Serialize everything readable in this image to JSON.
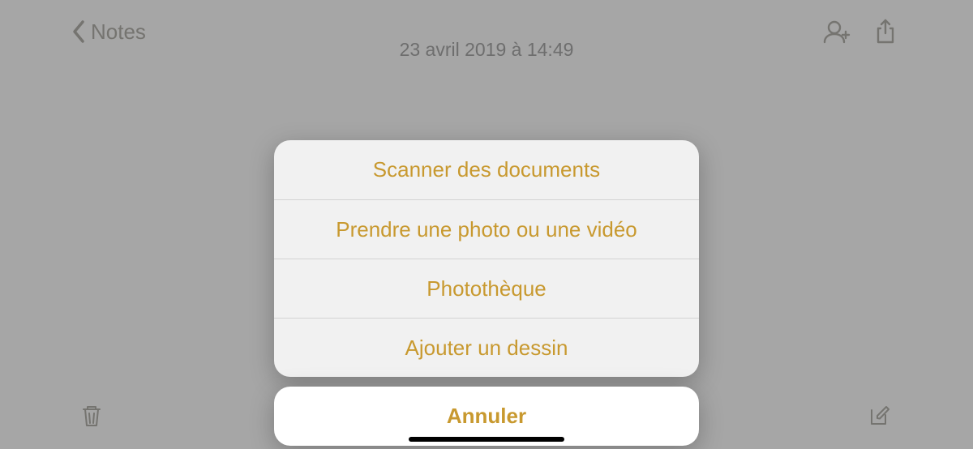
{
  "nav": {
    "back_label": "Notes"
  },
  "note": {
    "timestamp": "23 avril 2019 à 14:49"
  },
  "action_sheet": {
    "options": [
      "Scanner des documents",
      "Prendre une photo ou une vidéo",
      "Photothèque",
      "Ajouter un dessin"
    ],
    "cancel": "Annuler"
  }
}
